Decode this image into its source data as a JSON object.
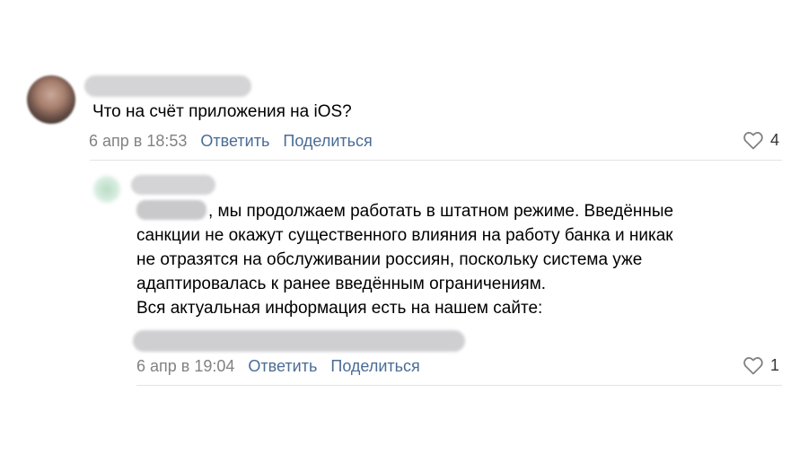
{
  "comments": [
    {
      "text": "Что на счёт приложения на iOS?",
      "date": "6 апр в 18:53",
      "reply_label": "Ответить",
      "share_label": "Поделиться",
      "likes": "4"
    }
  ],
  "reply": {
    "first_line_rest": ", мы продолжаем работать в штатном режиме. Введённые",
    "lines": [
      "санкции не окажут существенного влияния на работу банка и никак",
      "не отразятся на обслуживании россиян, поскольку система уже",
      "адаптировалась к ранее введённым ограничениям.",
      "Вся актуальная информация есть на нашем сайте:"
    ],
    "date": "6 апр в 19:04",
    "reply_label": "Ответить",
    "share_label": "Поделиться",
    "likes": "1"
  },
  "icons": {
    "like": "heart-outline-icon"
  },
  "colors": {
    "link": "#4a6c96",
    "meta": "#828282",
    "divider": "#e3e4e8",
    "blur_placeholder": "#d4d4d6"
  }
}
